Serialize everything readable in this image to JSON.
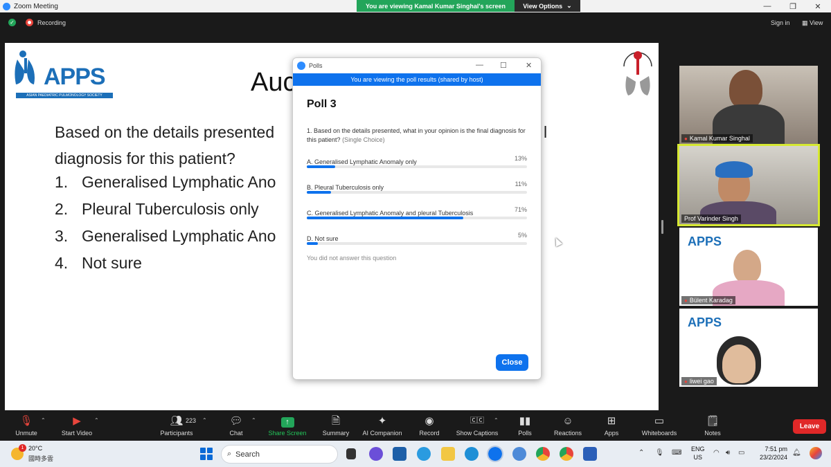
{
  "window": {
    "title": "Zoom Meeting",
    "share_banner": "You are viewing Kamal Kumar Singhal's screen",
    "view_options": "View Options",
    "controls": [
      "—",
      "❐",
      "✕"
    ]
  },
  "meeting_bar": {
    "recording_label": "Recording",
    "sign_in": "Sign in",
    "view": "View"
  },
  "slide": {
    "logo_word": "APPS",
    "logo_tagline": "ASIAN PAEDIATRIC PULMONOLOGY SOCIETY",
    "title": "Auc",
    "question_line1": "Based on the details presented",
    "question_line1_tail": "l",
    "question_line2": "diagnosis for this patient?",
    "list": [
      {
        "num": "1.",
        "text": "Generalised Lymphatic Ano"
      },
      {
        "num": "2.",
        "text": "Pleural Tuberculosis only"
      },
      {
        "num": "3.",
        "text": "Generalised Lymphatic Ano"
      },
      {
        "num": "4.",
        "text": "Not sure"
      }
    ]
  },
  "poll": {
    "window_title": "Polls",
    "banner": "You are viewing the poll results (shared by host)",
    "title": "Poll 3",
    "question": "1. Based on the details presented, what in your opinion is the final diagnosis for this patient?",
    "question_type": "(Single Choice)",
    "options": [
      {
        "label": "A. Generalised Lymphatic Anomaly only",
        "percent_label": "13%",
        "percent": 13
      },
      {
        "label": "B. Pleural Tuberculosis only",
        "percent_label": "11%",
        "percent": 11
      },
      {
        "label": "C. Generalised Lymphatic Anomaly and pleural Tuberculosis",
        "percent_label": "71%",
        "percent": 71
      },
      {
        "label": "D. Not sure",
        "percent_label": "5%",
        "percent": 5
      }
    ],
    "note": "You did not answer this question",
    "close_label": "Close"
  },
  "participants": [
    {
      "name": "Kamal Kumar Singhal",
      "muted": true
    },
    {
      "name": "Prof Varinder Singh",
      "muted": false,
      "active": true
    },
    {
      "name": "Bülent Karadag",
      "muted": true
    },
    {
      "name": "liwei gao",
      "muted": true
    }
  ],
  "participant_tile_logo": "APPS",
  "toolbar": {
    "unmute": "Unmute",
    "start_video": "Start Video",
    "participants": "Participants",
    "participant_count": "223",
    "chat": "Chat",
    "share_screen": "Share Screen",
    "summary": "Summary",
    "ai_companion": "AI Companion",
    "record": "Record",
    "show_captions": "Show Captions",
    "polls": "Polls",
    "reactions": "Reactions",
    "apps": "Apps",
    "whiteboards": "Whiteboards",
    "notes": "Notes",
    "leave": "Leave"
  },
  "taskbar": {
    "weather_temp": "20°C",
    "weather_desc": "國時多雲",
    "weather_badge": "1",
    "search_placeholder": "Search",
    "lang_line1": "ENG",
    "lang_line2": "US",
    "time": "7:51 pm",
    "date": "23/2/2024"
  },
  "colors": {
    "zoom_blue": "#0e72ed",
    "share_green": "#23a55a",
    "leave_red": "#e02828",
    "active_speaker": "#d6e832"
  }
}
